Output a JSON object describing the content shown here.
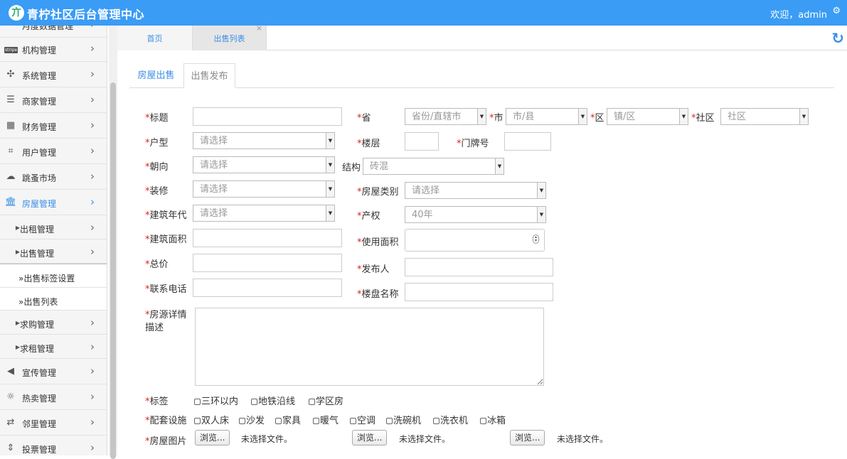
{
  "header": {
    "logo_glyph": "亣",
    "title": "青柠社区后台管理中心",
    "welcome": "欢迎，admin",
    "settings_icon": "gear-icon"
  },
  "sidebar": {
    "items": [
      {
        "label": "月度数据管理",
        "icon": "dashboard-icon"
      },
      {
        "label": "机构管理",
        "icon": "stripe-icon",
        "badge": "stripe"
      },
      {
        "label": "系统管理",
        "icon": "settings-icon"
      },
      {
        "label": "商家管理",
        "icon": "list-icon"
      },
      {
        "label": "财务管理",
        "icon": "calculator-icon"
      },
      {
        "label": "用户管理",
        "icon": "crop-icon"
      },
      {
        "label": "跳蚤市场",
        "icon": "cloud-icon"
      },
      {
        "label": "房屋管理",
        "icon": "bank-icon"
      },
      {
        "label": "出租管理",
        "icon": "caret-icon"
      },
      {
        "label": "出售管理",
        "icon": "caret-icon"
      },
      {
        "label": "»出售标签设置"
      },
      {
        "label": "»出售列表"
      },
      {
        "label": "求购管理",
        "icon": "caret-icon"
      },
      {
        "label": "求租管理",
        "icon": "caret-icon"
      },
      {
        "label": "宣传管理",
        "icon": "volume-icon"
      },
      {
        "label": "热卖管理",
        "icon": "sun-icon"
      },
      {
        "label": "邻里管理",
        "icon": "retweet-icon"
      },
      {
        "label": "投票管理",
        "icon": "sort-icon"
      }
    ]
  },
  "tabs": [
    {
      "label": "首页"
    },
    {
      "label": "出售列表",
      "close": "×"
    }
  ],
  "refresh_icon": "refresh-icon",
  "subtabs": [
    {
      "label": "房屋出售"
    },
    {
      "label": "出售发布"
    }
  ],
  "required_mark": "*",
  "form": {
    "title": "标题",
    "province": "省",
    "province_ph": "省份/直辖市",
    "city": "市",
    "city_ph": "市/县",
    "district": "区",
    "district_ph": "镇/区",
    "community": "社区",
    "community_ph": "社区",
    "layout": "户型",
    "layout_ph": "请选择",
    "floor": "楼层",
    "door": "门牌号",
    "orientation": "朝向",
    "orientation_ph": "请选择",
    "structure": "结构",
    "structure_val": "砖混",
    "decoration": "装修",
    "decoration_ph": "请选择",
    "house_type": "房屋类别",
    "house_type_ph": "请选择",
    "build_year": "建筑年代",
    "build_year_ph": "请选择",
    "property": "产权",
    "property_val": "40年",
    "build_area": "建筑面积",
    "use_area": "使用面积",
    "price": "总价",
    "publisher": "发布人",
    "phone": "联系电话",
    "estate": "楼盘名称",
    "desc_line1": "房源详情",
    "desc_line2": "描述",
    "tags": "标签",
    "tag_options": [
      "三环以内",
      "地铁沿线",
      "学区房"
    ],
    "facilities": "配套设施",
    "facility_options": [
      "双人床",
      "沙发",
      "家具",
      "暖气",
      "空调",
      "洗碗机",
      "洗衣机",
      "冰箱"
    ],
    "images": "房屋图片",
    "browse": "浏览...",
    "no_file": "未选择文件。"
  }
}
